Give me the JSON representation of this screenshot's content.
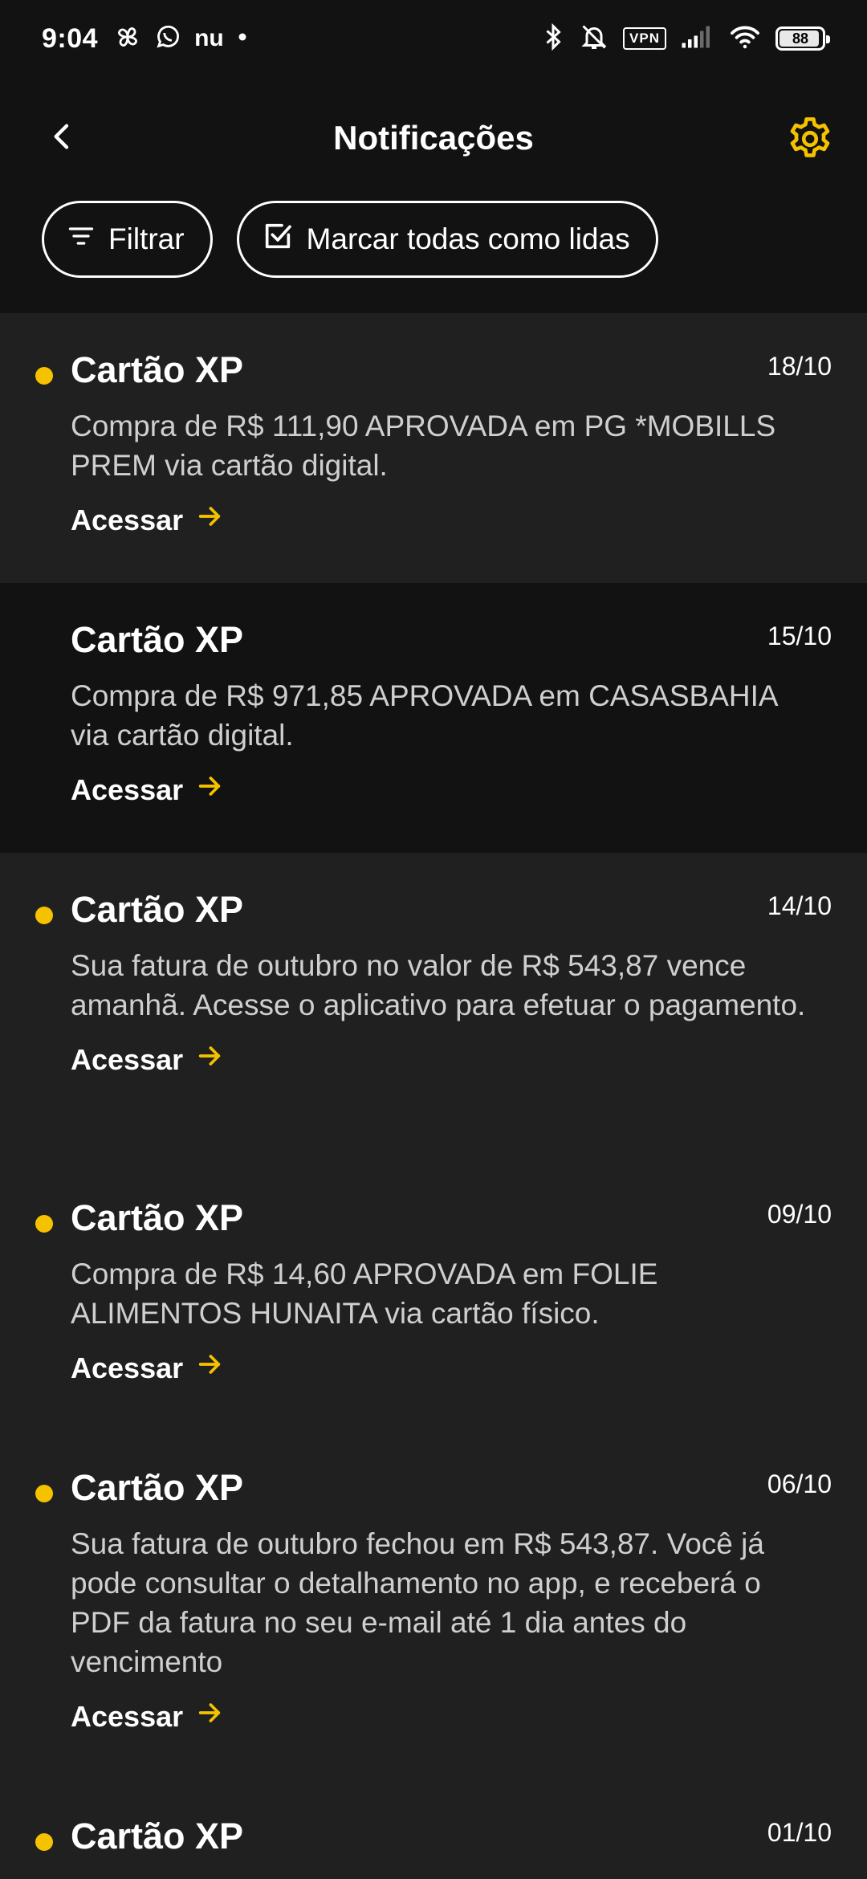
{
  "status_bar": {
    "time": "9:04",
    "left_icons": [
      "pinwheel-icon",
      "whatsapp-icon",
      "nu-icon",
      "dot-icon"
    ],
    "nu_text": "nu",
    "right_icons": [
      "bluetooth-icon",
      "mute-icon",
      "vpn-icon",
      "signal-icon",
      "wifi-icon",
      "battery-icon"
    ],
    "vpn_label": "VPN",
    "battery_level": "88"
  },
  "header": {
    "title": "Notificações",
    "back_icon": "chevron-left-icon",
    "settings_icon": "gear-icon"
  },
  "actions": {
    "filter_label": "Filtrar",
    "mark_all_label": "Marcar todas como lidas"
  },
  "colors": {
    "accent": "#F5C200",
    "unread_bg": "#202020",
    "read_bg": "#121212"
  },
  "notifications": [
    {
      "title": "Cartão XP",
      "date": "18/10",
      "body": "Compra de R$ 111,90 APROVADA em PG *MOBILLS PREM via cartão digital.",
      "link": "Acessar",
      "unread": true
    },
    {
      "title": "Cartão XP",
      "date": "15/10",
      "body": "Compra de R$ 971,85 APROVADA em CASASBAHIA via cartão digital.",
      "link": "Acessar",
      "unread": false
    },
    {
      "title": "Cartão XP",
      "date": "14/10",
      "body": "Sua fatura de outubro no valor de R$ 543,87 vence amanhã. Acesse o aplicativo para efetuar o pagamento.",
      "link": "Acessar",
      "unread": true
    },
    {
      "title": "Cartão XP",
      "date": "09/10",
      "body": "Compra de R$ 14,60 APROVADA em FOLIE ALIMENTOS HUNAITA via cartão físico.",
      "link": "Acessar",
      "unread": true
    },
    {
      "title": "Cartão XP",
      "date": "06/10",
      "body": "Sua fatura de outubro fechou em R$ 543,87. Você já pode consultar o detalhamento no app, e receberá o PDF da fatura no seu e-mail até 1 dia antes do vencimento",
      "link": "Acessar",
      "unread": true
    },
    {
      "title": "Cartão XP",
      "date": "01/10",
      "body": "",
      "link": "",
      "unread": true
    }
  ]
}
